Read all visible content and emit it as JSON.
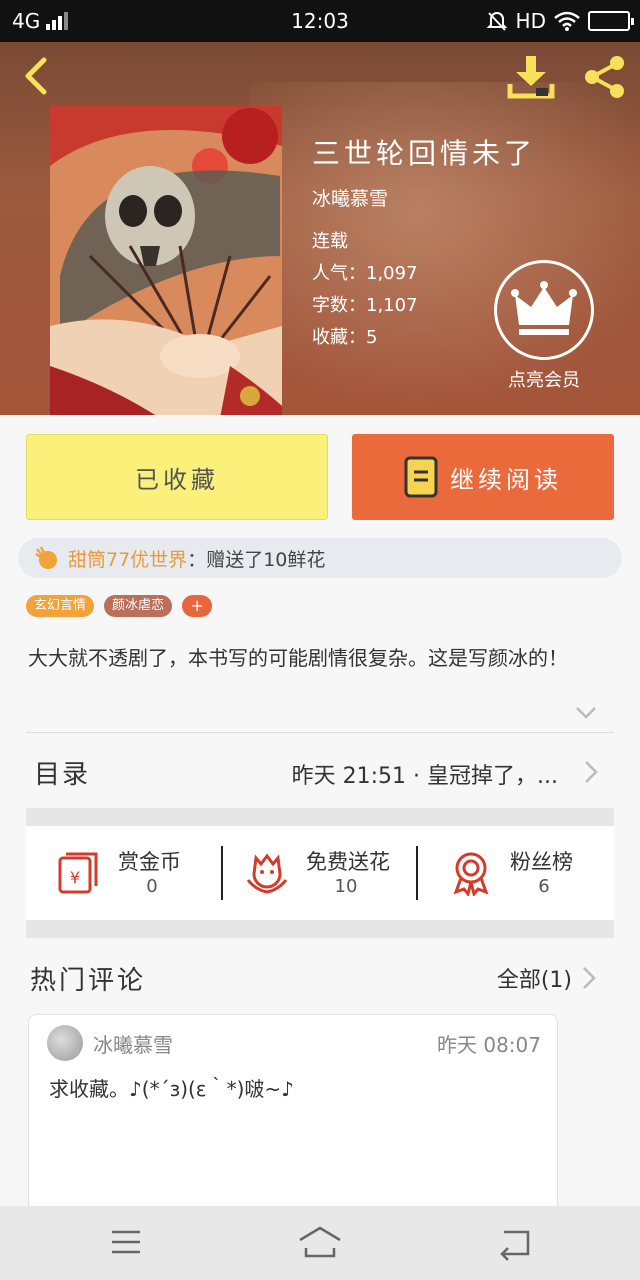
{
  "status_bar": {
    "network": "4G",
    "time": "12:03",
    "hd": "HD"
  },
  "book": {
    "title": "三世轮回情未了",
    "author": "冰曦慕雪",
    "status": "连载",
    "popularity": "人气：1,097",
    "word_count": "字数：1,107",
    "favorites": "收藏：5"
  },
  "vip": {
    "label": "点亮会员"
  },
  "actions": {
    "favorited_label": "已收藏",
    "continue_label": "继续阅读"
  },
  "gift_notice": {
    "user": "甜筒77优世界",
    "message": "：赠送了10鲜花"
  },
  "tags": [
    "玄幻言情",
    "颜冰虐恋",
    "+"
  ],
  "description": "大大就不透剧了，本书写的可能剧情很复杂。这是写颜冰的！",
  "toc": {
    "label": "目录",
    "latest": "昨天 21:51 · 皇冠掉了，..."
  },
  "stats": [
    {
      "label": "赏金币",
      "value": "0",
      "icon": "red-envelope-icon"
    },
    {
      "label": "免费送花",
      "value": "10",
      "icon": "flower-icon"
    },
    {
      "label": "粉丝榜",
      "value": "6",
      "icon": "medal-icon"
    }
  ],
  "comments": {
    "title": "热门评论",
    "all_label": "全部(1)",
    "items": [
      {
        "author": "冰曦慕雪",
        "time": "昨天 08:07",
        "text": "求收藏。♪(*´з)(ε｀*)啵~♪"
      }
    ]
  },
  "colors": {
    "accent_orange": "#ea6a3b",
    "favorited_yellow": "#fbf07a",
    "gift_user": "#e89a3c",
    "icon_red": "#d63a2a",
    "header_icon_yellow": "#f5e25a"
  }
}
